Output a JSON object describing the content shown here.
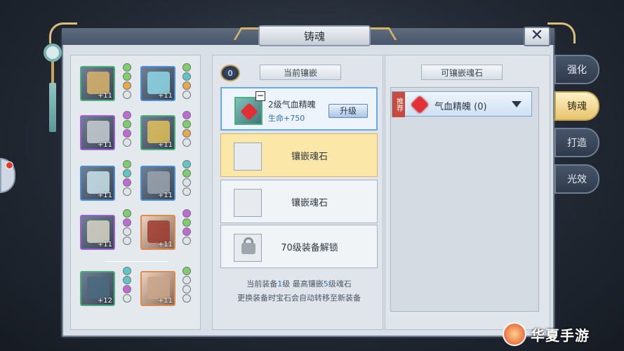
{
  "window": {
    "title": "铸魂",
    "close_label": "✕"
  },
  "equipment": {
    "slots": [
      {
        "level": "+11",
        "tier": "green"
      },
      {
        "level": "+11",
        "tier": "blue"
      },
      {
        "level": "+11",
        "tier": "purple"
      },
      {
        "level": "+11",
        "tier": "green"
      },
      {
        "level": "+11",
        "tier": "blue"
      },
      {
        "level": "+11",
        "tier": "blue"
      },
      {
        "level": "+11",
        "tier": "purple"
      },
      {
        "level": "+11",
        "tier": "red"
      },
      {
        "level": "+12",
        "tier": "green"
      },
      {
        "level": "+11",
        "tier": "red"
      }
    ]
  },
  "middle": {
    "badge": "0",
    "header": "当前镶嵌",
    "socket1": {
      "name": "2级气血精魄",
      "stat": "生命+750",
      "upgrade_label": "升级",
      "remove_label": "−"
    },
    "socket2": {
      "text": "镶嵌魂石"
    },
    "socket3": {
      "text": "镶嵌魂石"
    },
    "socket4": {
      "text": "70级装备解锁"
    },
    "info_line1_a": "当前装备",
    "info_line1_b": "1",
    "info_line1_c": "级 最高镶嵌",
    "info_line1_d": "5",
    "info_line1_e": "级魂石",
    "info_line2": "更换装备时宝石会自动转移至新装备"
  },
  "right": {
    "header": "可镶嵌魂石",
    "gem": {
      "tag": "推荐",
      "name": "气血精魄 (0)"
    }
  },
  "tabs": {
    "strengthen": "强化",
    "forge_soul": "铸魂",
    "craft": "打造",
    "effect": "光效"
  },
  "watermark": {
    "text": "华夏手游"
  },
  "colors": {
    "accent_blue": "#2f6fb9",
    "tab_active": "#e7c46e",
    "gem_red": "#e23236"
  }
}
